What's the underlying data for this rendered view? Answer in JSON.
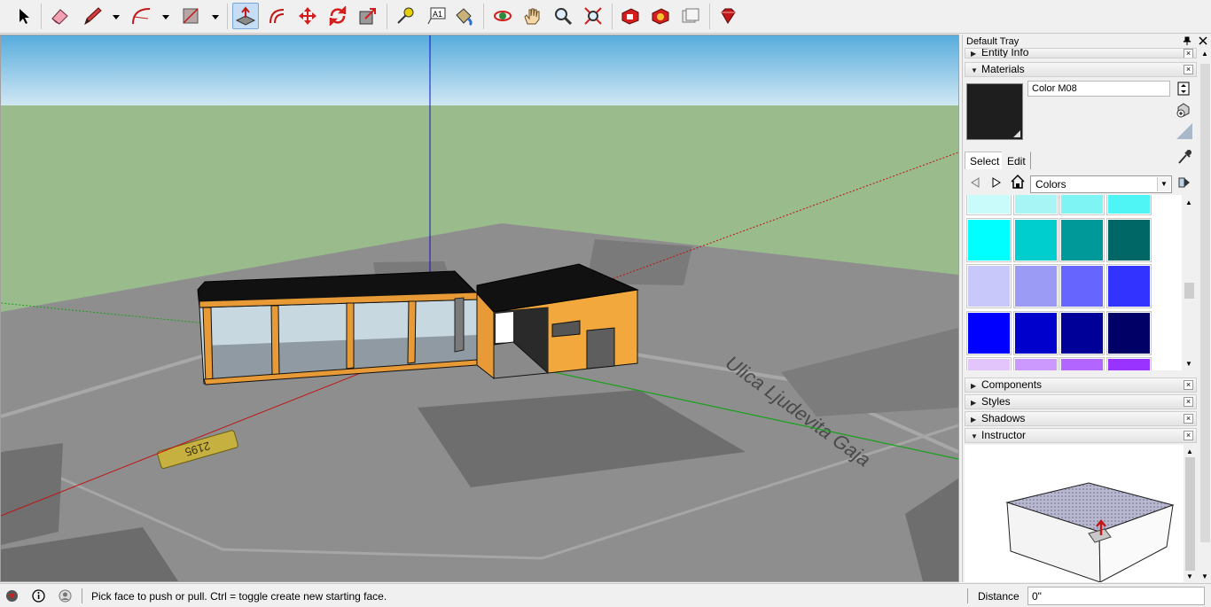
{
  "toolbar": {
    "tools": [
      {
        "name": "select-tool"
      },
      {
        "name": "eraser-tool"
      },
      {
        "name": "line-tool"
      },
      {
        "name": "arc-tool"
      },
      {
        "name": "rectangle-tool"
      },
      {
        "name": "push-pull-tool",
        "active": true
      },
      {
        "name": "offset-tool"
      },
      {
        "name": "move-tool"
      },
      {
        "name": "rotate-tool"
      },
      {
        "name": "scale-tool"
      },
      {
        "name": "tape-measure-tool"
      },
      {
        "name": "text-tool"
      },
      {
        "name": "paint-bucket-tool"
      },
      {
        "name": "orbit-tool"
      },
      {
        "name": "pan-tool"
      },
      {
        "name": "zoom-tool"
      },
      {
        "name": "zoom-extents-tool"
      },
      {
        "name": "warehouse-tool"
      },
      {
        "name": "extension-warehouse-tool"
      },
      {
        "name": "layout-tool"
      },
      {
        "name": "ruby-console-tool"
      }
    ],
    "text_tool_label": "A1"
  },
  "tray": {
    "title": "Default Tray",
    "panels": {
      "entity_info": "Entity Info",
      "materials": "Materials",
      "components": "Components",
      "styles": "Styles",
      "shadows": "Shadows",
      "instructor": "Instructor"
    }
  },
  "materials": {
    "current_name": "Color M08",
    "current_color": "#1e1e1e",
    "tabs": {
      "select": "Select",
      "edit": "Edit"
    },
    "library": "Colors",
    "swatches": [
      [
        "#c9fbfb",
        "#a8f5f5",
        "#7ef4f4",
        "#4ff4f4"
      ],
      [
        "#00ffff",
        "#00cdcd",
        "#009999",
        "#006666"
      ],
      [
        "#c8c8fa",
        "#9b9bf5",
        "#6666ff",
        "#3333ff"
      ],
      [
        "#0000ff",
        "#0000cd",
        "#000099",
        "#000066"
      ],
      [
        "#e2c6fb",
        "#cc99ff",
        "#b266ff",
        "#9933ff"
      ]
    ]
  },
  "viewport": {
    "street_label": "Ulica Ljudevita Gaja",
    "house_number": "2195"
  },
  "status": {
    "message": "Pick face to push or pull.  Ctrl = toggle create new starting face.",
    "measurement_label": "Distance",
    "measurement_value": "0\""
  }
}
